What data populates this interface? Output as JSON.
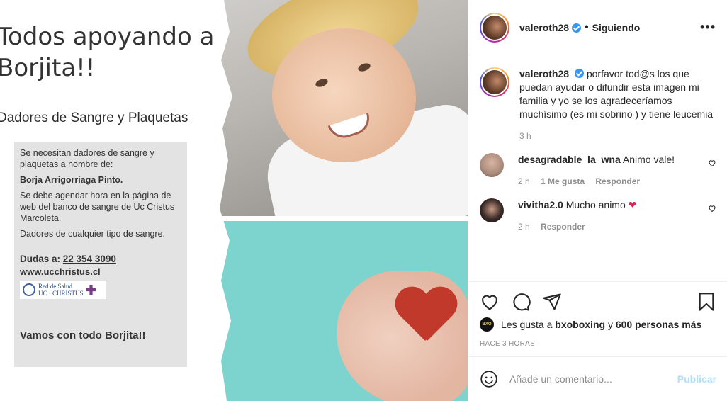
{
  "post_image": {
    "headline_line1": "Todos apoyando a",
    "headline_line2": "Borjita!!",
    "subhead": "Dadores de Sangre y Plaquetas",
    "info": {
      "line1": "Se necesitan dadores de sangre y plaquetas a nombre de:",
      "name": "Borja Arrigorriaga Pinto.",
      "line2": "Se debe agendar hora en la página de web del banco de sangre de Uc Cristus Marcoleta.",
      "line3": "Dadores de cualquier tipo de sangre.",
      "dudas_label": "Dudas a:",
      "phone": "22 354 3090",
      "website": "www.ucchristus.cl",
      "logo_line1": "Red de Salud",
      "logo_line2": "UC · CHRISTUS",
      "closing": "Vamos con todo Borjita!!"
    }
  },
  "header": {
    "username": "valeroth28",
    "separator": "•",
    "following_label": "Siguiendo",
    "more_label": "•••"
  },
  "caption": {
    "username": "valeroth28",
    "text": "porfavor tod@s los que puedan ayudar o difundir esta imagen mi familia y yo se los agradeceríamos muchísimo (es mi sobrino ) y tiene leucemia",
    "time": "3 h"
  },
  "comments": [
    {
      "username": "desagradable_la_wna",
      "text": "Animo vale!",
      "time": "2 h",
      "likes": "1 Me gusta",
      "reply_label": "Responder",
      "avatar_color": "#a98a7c"
    },
    {
      "username": "vivitha2.0",
      "text": "Mucho animo",
      "emoji": "❤",
      "time": "2 h",
      "reply_label": "Responder",
      "avatar_color": "#3a2a26"
    }
  ],
  "likes": {
    "badge": "BXO",
    "prefix": "Les gusta a",
    "user": "bxoboxing",
    "connector": "y",
    "others": "600 personas más"
  },
  "time_ago": "HACE 3 HORAS",
  "add_comment": {
    "placeholder": "Añade un comentario...",
    "publish_label": "Publicar"
  },
  "colors": {
    "verified": "#3897f0",
    "publish_disabled": "#b2dffc",
    "meta_gray": "#8e8e8e",
    "heart_red": "#e0245e"
  }
}
